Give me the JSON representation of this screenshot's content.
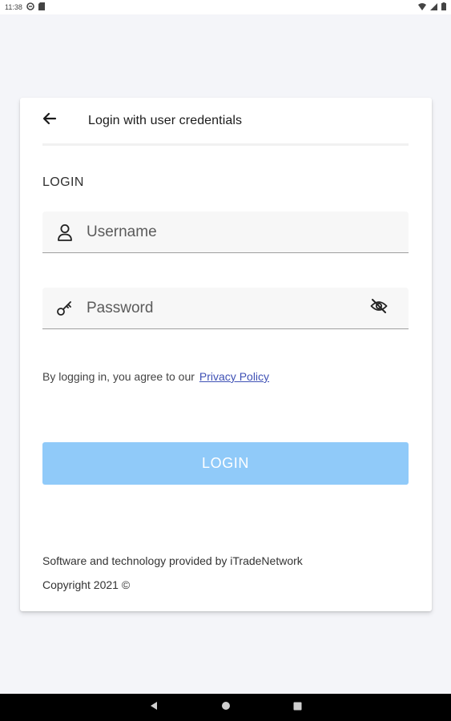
{
  "status_bar": {
    "time": "11:38"
  },
  "header": {
    "title": "Login with user credentials"
  },
  "form": {
    "section_label": "LOGIN",
    "username_placeholder": "Username",
    "password_placeholder": "Password",
    "agree_text": "By logging in, you agree to our",
    "privacy_link": "Privacy Policy",
    "login_button": "LOGIN"
  },
  "footer": {
    "provider": "Software and technology provided by iTradeNetwork",
    "copyright": "Copyright 2021 ©"
  },
  "colors": {
    "page_bg": "#f4f5f9",
    "card_bg": "#ffffff",
    "button_bg": "#90caf9",
    "link": "#3f51b5",
    "nav_bar": "#000000"
  },
  "icons": {
    "back": "arrow-left",
    "username": "person-outline",
    "password": "key",
    "visibility": "eye-off",
    "nav": [
      "back-triangle",
      "home-circle",
      "recents-square"
    ]
  }
}
